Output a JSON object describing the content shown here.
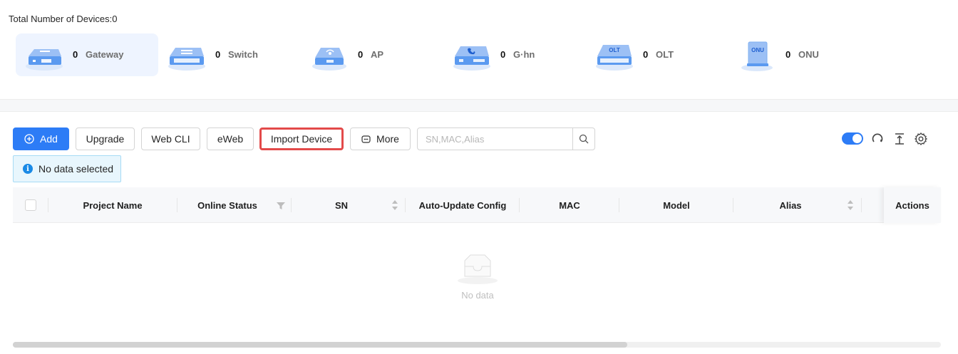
{
  "summary": {
    "total_label": "Total Number of Devices:0",
    "devices": [
      {
        "count": "0",
        "name": "Gateway",
        "icon": "gateway-icon",
        "active": true
      },
      {
        "count": "0",
        "name": "Switch",
        "icon": "switch-icon",
        "active": false
      },
      {
        "count": "0",
        "name": "AP",
        "icon": "ap-icon",
        "active": false
      },
      {
        "count": "0",
        "name": "G·hn",
        "icon": "ghn-icon",
        "active": false
      },
      {
        "count": "0",
        "name": "OLT",
        "icon": "olt-icon",
        "active": false
      },
      {
        "count": "0",
        "name": "ONU",
        "icon": "onu-icon",
        "active": false
      }
    ],
    "olt_badge": "OLT",
    "onu_badge": "ONU"
  },
  "toolbar": {
    "add_label": "Add",
    "upgrade_label": "Upgrade",
    "webcli_label": "Web CLI",
    "eweb_label": "eWeb",
    "import_label": "Import Device",
    "more_label": "More",
    "search_placeholder": "SN,MAC,Alias",
    "toggle_on": true
  },
  "selection": {
    "info_text": "No data selected"
  },
  "table": {
    "columns": {
      "project_name": "Project Name",
      "online_status": "Online Status",
      "sn": "SN",
      "auto_update": "Auto-Update Config",
      "mac": "MAC",
      "model": "Model",
      "alias": "Alias",
      "actions": "Actions"
    },
    "empty_text": "No data"
  },
  "colors": {
    "primary": "#2d7cf6",
    "highlight_border": "#e34a4a",
    "info_bg": "#e8f6fd"
  }
}
